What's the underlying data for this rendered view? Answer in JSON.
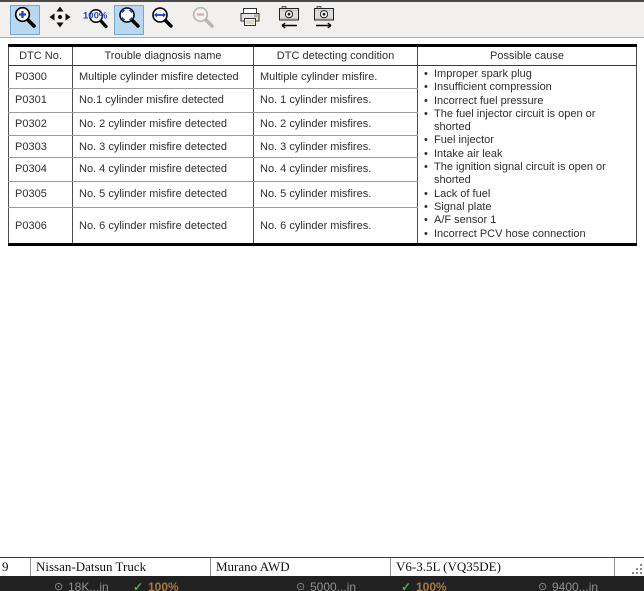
{
  "toolbar": {
    "buttons": [
      {
        "name": "zoom-in",
        "state": "selected"
      },
      {
        "name": "pan",
        "state": "normal"
      },
      {
        "name": "zoom-100",
        "state": "normal"
      },
      {
        "name": "fit-page",
        "state": "selected"
      },
      {
        "name": "fit-width",
        "state": "normal"
      },
      {
        "name": "zoom-out",
        "state": "disabled"
      },
      {
        "name": "print",
        "state": "normal"
      },
      {
        "name": "previous-image",
        "state": "normal"
      },
      {
        "name": "next-image",
        "state": "normal"
      }
    ]
  },
  "table": {
    "columns": [
      "DTC No.",
      "Trouble diagnosis name",
      "DTC detecting condition",
      "Possible cause"
    ],
    "rows": [
      {
        "dtc_no": "P0300",
        "trouble_diagnosis_name": "Multiple cylinder misfire detected",
        "dtc_detecting_condition": "Multiple cylinder misfire."
      },
      {
        "dtc_no": "P0301",
        "trouble_diagnosis_name": "No.1 cylinder misfire detected",
        "dtc_detecting_condition": "No. 1 cylinder misfires."
      },
      {
        "dtc_no": "P0302",
        "trouble_diagnosis_name": "No. 2 cylinder misfire detected",
        "dtc_detecting_condition": "No. 2 cylinder misfires."
      },
      {
        "dtc_no": "P0303",
        "trouble_diagnosis_name": "No. 3 cylinder misfire detected",
        "dtc_detecting_condition": "No. 3 cylinder misfires."
      },
      {
        "dtc_no": "P0304",
        "trouble_diagnosis_name": "No. 4 cylinder misfire detected",
        "dtc_detecting_condition": "No. 4 cylinder misfires."
      },
      {
        "dtc_no": "P0305",
        "trouble_diagnosis_name": "No. 5 cylinder misfire detected",
        "dtc_detecting_condition": "No. 5 cylinder misfires."
      },
      {
        "dtc_no": "P0306",
        "trouble_diagnosis_name": "No. 6 cylinder misfire detected",
        "dtc_detecting_condition": "No. 6 cylinder misfires."
      }
    ],
    "possible_causes": [
      "Improper spark plug",
      "Insufficient compression",
      "Incorrect fuel pressure",
      "The fuel injector circuit is open or shorted",
      "Fuel injector",
      "Intake air leak",
      "The ignition signal circuit is open or shorted",
      "Lack of fuel",
      "Signal plate",
      "A/F sensor 1",
      "Incorrect PCV hose connection"
    ]
  },
  "status_bar": {
    "record_number": "9",
    "vehicle_make": "Nissan-Datsun Truck",
    "vehicle_model": "Murano AWD",
    "engine": "V6-3.5L (VQ35DE)"
  },
  "bottom_bar": {
    "items": [
      {
        "icon": "gauge-icon",
        "text": "18K...in"
      },
      {
        "icon": "check-icon",
        "text": "100%"
      },
      {
        "icon": "gauge-icon",
        "text": "5000...in"
      },
      {
        "icon": "check-icon",
        "text": "100%"
      },
      {
        "icon": "gauge-icon",
        "text": "9400...in"
      }
    ]
  },
  "colors": {
    "accent_blue": "#1f3fd0",
    "selected_tile_bg": "#b9d7ee",
    "selected_tile_border": "#74a7cf",
    "bottom_bar_bg": "#212121",
    "bottom_bar_green": "#4caf50",
    "bottom_bar_amber": "#a87843"
  }
}
